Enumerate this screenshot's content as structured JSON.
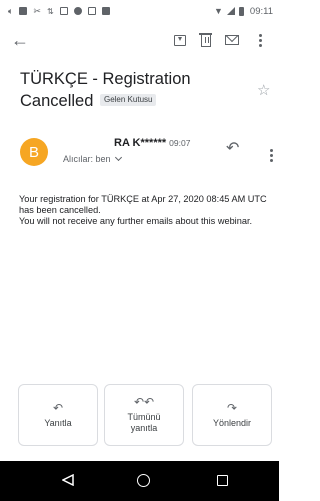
{
  "status_bar": {
    "time": "09:11",
    "icons": [
      "sound-icon",
      "facebook-icon",
      "share-icon",
      "network-icon",
      "image-icon",
      "opera-icon",
      "gallery-icon",
      "message-icon",
      "wifi-icon",
      "signal-icon",
      "battery-icon"
    ]
  },
  "toolbar": {
    "back_icon": "arrow-left-icon",
    "archive_icon": "archive-icon",
    "delete_icon": "trash-icon",
    "mail_icon": "envelope-icon",
    "more_icon": "more-vert-icon"
  },
  "email": {
    "subject": "TÜRKÇE - Registration Cancelled",
    "label": "Gelen Kutusu",
    "sender_initial": "B",
    "sender_name": "RA K******",
    "time": "09:07",
    "recipients": "Alıcılar: ben",
    "body": [
      "Your registration for TÜRKÇE at Apr 27, 2020 08:45 AM UTC has been cancelled.",
      "You will not receive any further emails about this webinar."
    ],
    "avatar_color": "#f6a623"
  },
  "actions": {
    "reply": "Yanıtla",
    "reply_all": "Tümünü yanıtla",
    "forward": "Yönlendir"
  }
}
